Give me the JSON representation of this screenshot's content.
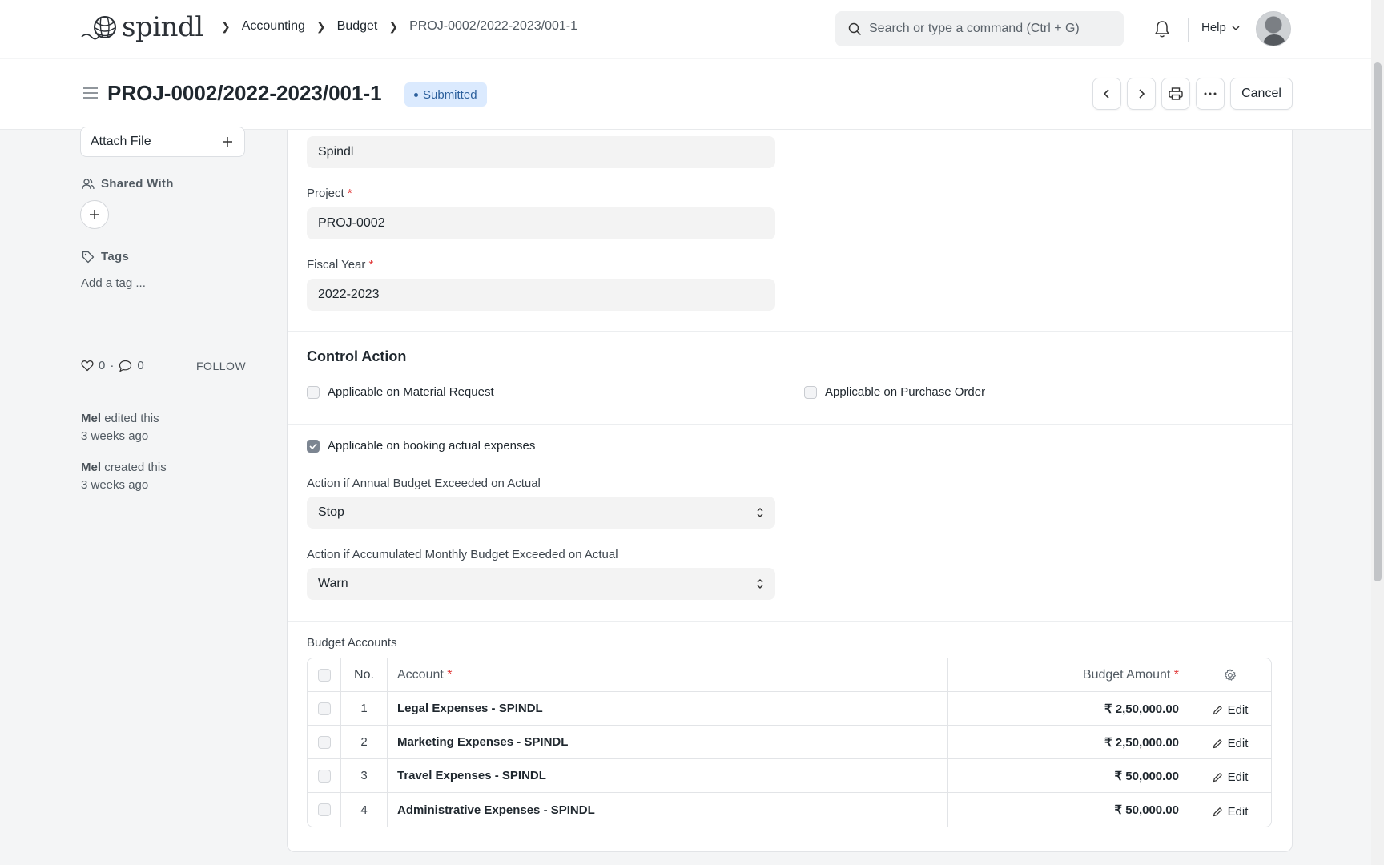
{
  "brand": {
    "name": "spindl"
  },
  "breadcrumb": [
    "Accounting",
    "Budget",
    "PROJ-0002/2022-2023/001-1"
  ],
  "search": {
    "placeholder": "Search or type a command (Ctrl + G)"
  },
  "nav": {
    "help_label": "Help"
  },
  "header": {
    "title": "PROJ-0002/2022-2023/001-1",
    "status": "Submitted",
    "cancel_label": "Cancel"
  },
  "sidebar": {
    "attach_label": "Attach File",
    "shared_with_label": "Shared With",
    "tags_label": "Tags",
    "add_tag_label": "Add a tag ...",
    "likes": "0",
    "comments": "0",
    "follow_label": "FOLLOW",
    "activity": [
      {
        "user": "Mel",
        "action": "edited this",
        "time": "3 weeks ago"
      },
      {
        "user": "Mel",
        "action": "created this",
        "time": "3 weeks ago"
      }
    ]
  },
  "form": {
    "company_value": "Spindl",
    "project_label": "Project",
    "project_value": "PROJ-0002",
    "fiscal_year_label": "Fiscal Year",
    "fiscal_year_value": "2022-2023",
    "required_mark": "*",
    "control_action_title": "Control Action",
    "chk_material_request": "Applicable on Material Request",
    "chk_purchase_order": "Applicable on Purchase Order",
    "chk_booking_actual": "Applicable on booking actual expenses",
    "annual_action_label": "Action if Annual Budget Exceeded on Actual",
    "annual_action_value": "Stop",
    "monthly_action_label": "Action if Accumulated Monthly Budget Exceeded on Actual",
    "monthly_action_value": "Warn"
  },
  "budget_accounts": {
    "label": "Budget Accounts",
    "columns": {
      "no": "No.",
      "account": "Account",
      "amount": "Budget Amount"
    },
    "edit_label": "Edit",
    "rows": [
      {
        "no": "1",
        "account": "Legal Expenses - SPINDL",
        "amount": "₹ 2,50,000.00"
      },
      {
        "no": "2",
        "account": "Marketing Expenses - SPINDL",
        "amount": "₹ 2,50,000.00"
      },
      {
        "no": "3",
        "account": "Travel Expenses - SPINDL",
        "amount": "₹ 50,000.00"
      },
      {
        "no": "4",
        "account": "Administrative Expenses - SPINDL",
        "amount": "₹ 50,000.00"
      }
    ]
  }
}
